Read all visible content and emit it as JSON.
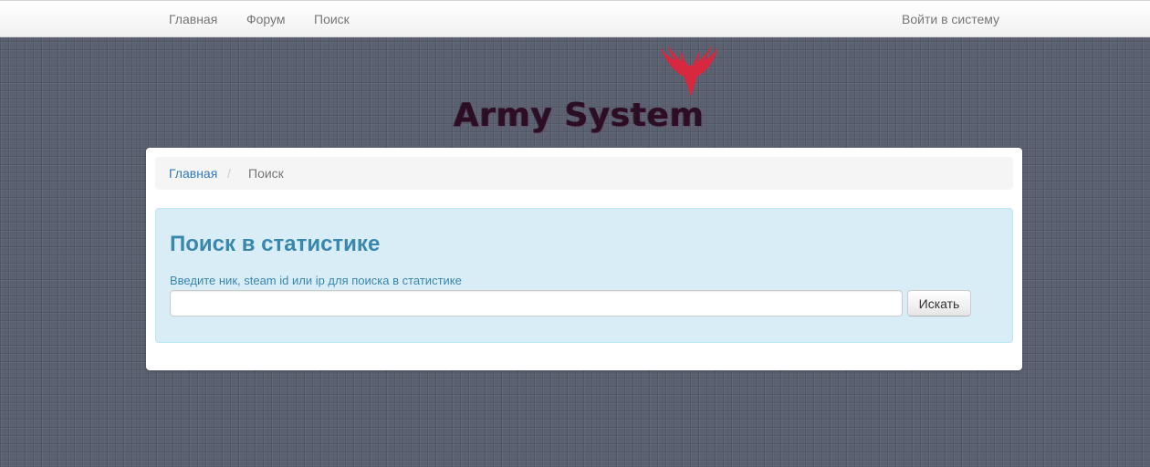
{
  "navbar": {
    "items": [
      {
        "label": "Главная"
      },
      {
        "label": "Форум"
      },
      {
        "label": "Поиск"
      }
    ],
    "login_label": "Войти в систему"
  },
  "logo": {
    "text": "Army System",
    "icon": "phoenix-icon",
    "colors": {
      "bird": "#d8283f",
      "text": "#2b0d24"
    }
  },
  "breadcrumb": {
    "home": "Главная",
    "separator": "/",
    "current": "Поиск"
  },
  "search_panel": {
    "title": "Поиск в статистике",
    "label": "Введите ник, steam id или ip для поиска в статистике",
    "input_value": "",
    "button_label": "Искать"
  },
  "colors": {
    "background": "#5b6170",
    "link": "#337ab7",
    "info_text": "#3a87ad",
    "info_bg": "#d9edf7"
  }
}
